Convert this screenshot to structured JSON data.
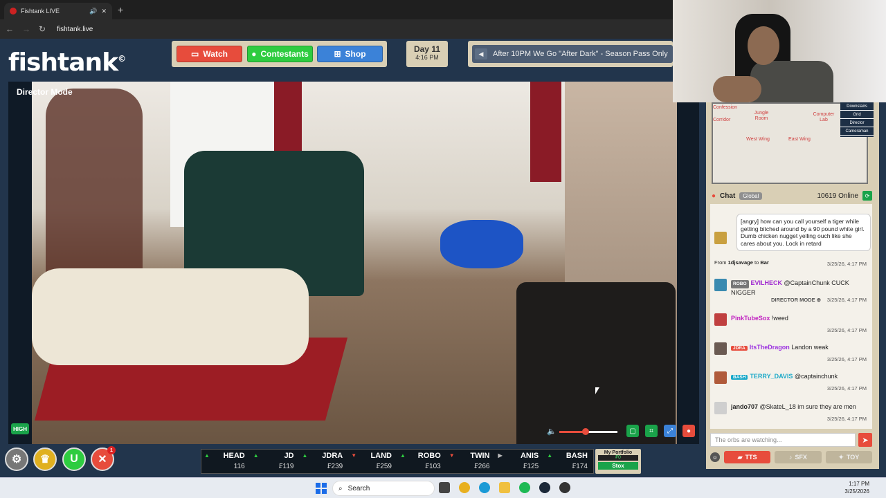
{
  "browser": {
    "tab_title": "Fishtank LIVE",
    "new_tab": "+",
    "url": "fishtank.live",
    "tab_close": "✕",
    "mute_glyph": "🔊"
  },
  "logo": {
    "text": "fishtank",
    "mark": "©"
  },
  "nav": {
    "watch": "Watch",
    "contestants": "Contestants",
    "shop": "Shop"
  },
  "day": {
    "label": "Day 11",
    "time": "4:16 PM"
  },
  "marquee": {
    "text": "After 10PM We Go \"After Dark\" - Season Pass Only"
  },
  "player": {
    "mode": "Director Mode",
    "quality": "HIGH",
    "volume_level": 0.45
  },
  "controls": {
    "badge_count": "1"
  },
  "ticker": [
    {
      "name": "HEAD",
      "value": "116",
      "trend": "up"
    },
    {
      "name": "JD",
      "value": "₣119",
      "trend": "up"
    },
    {
      "name": "JDRA",
      "value": "₣239",
      "trend": "up"
    },
    {
      "name": "LAND",
      "value": "₣259",
      "trend": "down"
    },
    {
      "name": "ROBO",
      "value": "₣103",
      "trend": "up"
    },
    {
      "name": "TWIN",
      "value": "₣266",
      "trend": "down"
    },
    {
      "name": "ANIS",
      "value": "₣125",
      "trend": "flat"
    },
    {
      "name": "BASH",
      "value": "₣174",
      "trend": "up"
    }
  ],
  "portfolio": {
    "label": "My Portfolio",
    "value": "₣0",
    "button": "Stox"
  },
  "map": {
    "rooms": [
      "Jungle Room",
      "Computer Lab",
      "West Wing",
      "East Wing",
      "Corridor",
      "Confession"
    ],
    "menu": [
      "Downstairs",
      "Grid",
      "Director",
      "Cameraman"
    ]
  },
  "chat": {
    "title": "Chat",
    "scope": "Global",
    "online": "10619 Online",
    "messages": [
      {
        "text": "[angry] how can you call yourself a tiger while getting bitched around by a 90 pound white girl. Dumb chicken nugget yelling ouch like she cares about you. Lock in retard",
        "from_prefix": "From",
        "from": "1djsavage",
        "to_prefix": "to",
        "to": "Bar",
        "time": "3/25/26, 4:17 PM"
      },
      {
        "tag": "ROBO",
        "user": "EVILHECK",
        "text": "@CaptainChunk CUCK NIGGER",
        "extra": "DIRECTOR MODE ⊕",
        "time": "3/25/26, 4:17 PM"
      },
      {
        "user": "PinkTubeSox",
        "text": "!weed",
        "time": "3/25/26, 4:17 PM"
      },
      {
        "tag": "JDRA",
        "user": "ItsTheDragon",
        "text": "Landon weak",
        "time": "3/25/26, 4:17 PM"
      },
      {
        "tag": "BASH",
        "user": "TERRY_DAVIS",
        "text": "@captainchunk",
        "time": "3/25/26, 4:17 PM"
      },
      {
        "user": "jando707",
        "text": "@SkateL_18 im sure they are men",
        "time": "3/25/26, 4:17 PM"
      }
    ],
    "input_placeholder": "The orbs are watching...",
    "tts": "TTS",
    "sfx": "SFX",
    "toy": "TOY"
  },
  "taskbar": {
    "search": "Search",
    "time": "1:17 PM",
    "date": "3/25/2026"
  },
  "colors": {
    "watch": "#e74c3c",
    "contestants": "#2ecc40",
    "shop": "#3b82d8"
  }
}
